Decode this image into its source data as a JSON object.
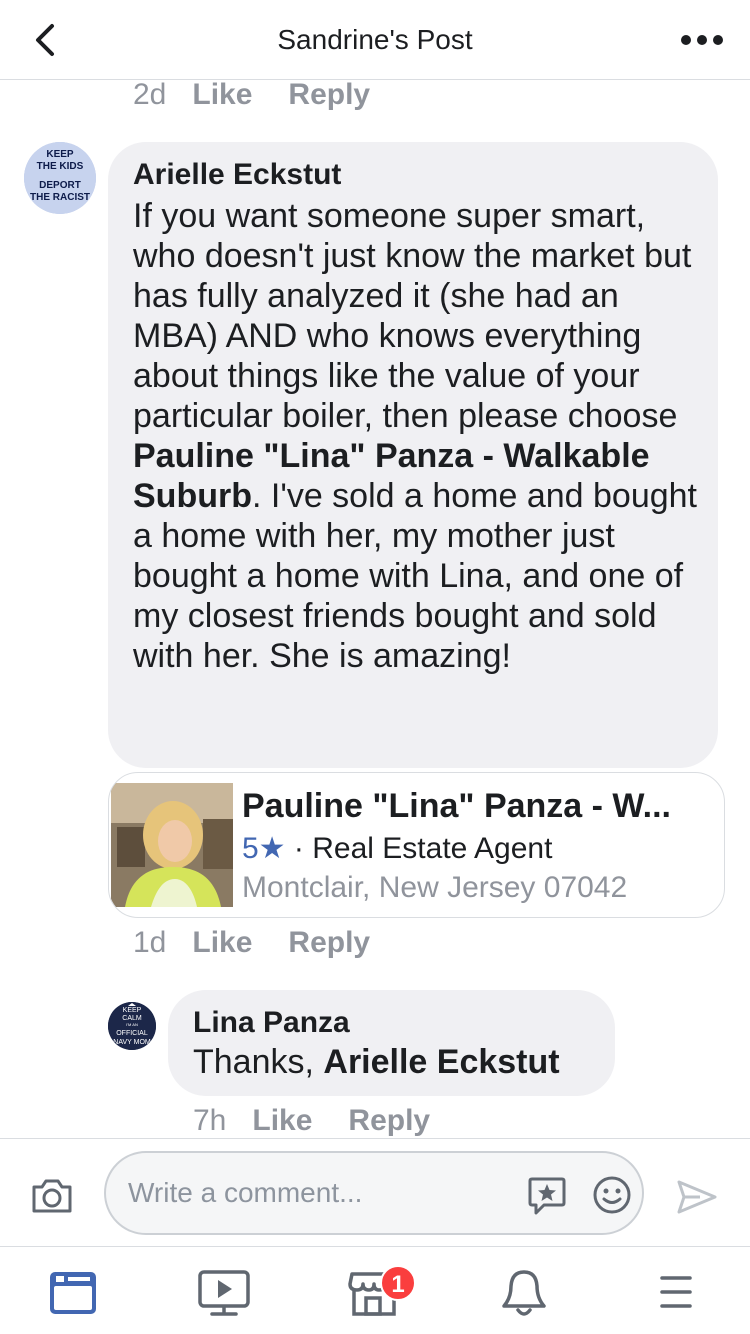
{
  "header": {
    "title": "Sandrine's Post",
    "back_icon": "chevron-left-icon",
    "more_icon": "more-horizontal-icon"
  },
  "prev_comment_meta": {
    "time": "2d",
    "like": "Like",
    "reply": "Reply"
  },
  "comment1": {
    "author": "Arielle Eckstut",
    "avatar_text": [
      "KEEP",
      "THE KIDS",
      "DEPORT",
      "THE RACIST"
    ],
    "text_part1": "If you want someone super smart, who doesn't just know the market but has fully analyzed it (she had an MBA) AND who knows everything about things like the value of your particular boiler, then please choose ",
    "text_mention": "Pauline \"Lina\" Panza - Walkable Suburb",
    "text_part2": ". I've sold a home and bought a home with her, my mother just bought a home with Lina, and one of my closest friends bought and sold with her. She is amazing!",
    "meta": {
      "time": "1d",
      "like": "Like",
      "reply": "Reply"
    }
  },
  "page_card": {
    "name": "Pauline \"Lina\" Panza - W...",
    "rating": "5★",
    "separator": " · ",
    "category": "Real Estate Agent",
    "location": "Montclair, New Jersey 07042"
  },
  "reply1": {
    "author": "Lina Panza",
    "avatar_text": [
      "KEEP",
      "CALM",
      "I'M AN",
      "OFFICIAL",
      "NAVY MOM"
    ],
    "text_prefix": "Thanks, ",
    "text_mention": "Arielle Eckstut",
    "meta": {
      "time": "7h",
      "like": "Like",
      "reply": "Reply"
    }
  },
  "composer": {
    "placeholder": "Write a comment...",
    "camera_icon": "camera-icon",
    "sticker_icon": "sticker-icon",
    "emoji_icon": "emoji-icon",
    "send_icon": "send-icon"
  },
  "tabbar": {
    "items": [
      "news-feed-icon",
      "watch-icon",
      "marketplace-icon",
      "notifications-icon",
      "menu-icon"
    ],
    "marketplace_badge": "1"
  },
  "colors": {
    "accent": "#4267b2",
    "bubble": "#f0f0f3",
    "meta": "#90949c",
    "badge": "#fa3e3e"
  }
}
